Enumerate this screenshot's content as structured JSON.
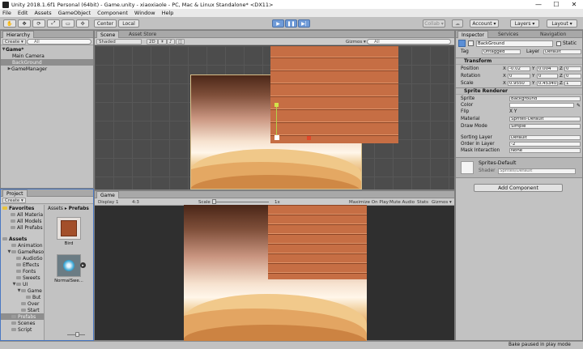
{
  "window": {
    "title": "Unity 2018.1.6f1 Personal (64bit) - Game.unity - xiaoxiaole - PC, Mac & Linux Standalone* <DX11>",
    "controls": [
      "—",
      "☐",
      "✕"
    ]
  },
  "menu": [
    "File",
    "Edit",
    "Assets",
    "GameObject",
    "Component",
    "Window",
    "Help"
  ],
  "toolbar": {
    "tools": [
      "✋",
      "✥",
      "⟳",
      "⤢",
      "▭",
      "✣"
    ],
    "pivot": "Center",
    "space": "Local",
    "play": "▶",
    "pause": "❚❚",
    "step": "▶|",
    "collab": "Collab ▾",
    "cloud": "☁",
    "account": "Account ▾",
    "layers": "Layers ▾",
    "layout": "Layout ▾"
  },
  "hierarchy": {
    "tab": "Hierarchy",
    "create": "Create ▾",
    "search": "All",
    "root": "Game*",
    "items": [
      "Main Camera",
      "BackGround",
      "GameManager"
    ],
    "root_expand": "▼",
    "gm_expand": "▶"
  },
  "scene": {
    "tabs": [
      "Scene",
      "Asset Store"
    ],
    "shading": "Shaded",
    "mode2d": "2D",
    "toggles": [
      "☀",
      "♪",
      "◫"
    ],
    "gizmos": "Gizmos ▾",
    "search": "All"
  },
  "game": {
    "tab": "Game",
    "display": "Display 1",
    "aspect": "4:3",
    "scale_label": "Scale",
    "scale_value": "1x",
    "buttons": [
      "Maximize On Play",
      "Mute Audio",
      "Stats",
      "Gizmos ▾"
    ]
  },
  "project": {
    "tab": "Project",
    "create": "Create ▾",
    "favorites_label": "Favorites",
    "favorites": [
      "All Materia",
      "All Models",
      "All Prefabs"
    ],
    "assets_label": "Assets",
    "tree": [
      {
        "label": "Animation",
        "indent": 1,
        "arrow": ""
      },
      {
        "label": "GameReso",
        "indent": 1,
        "arrow": "▼"
      },
      {
        "label": "AudioSo",
        "indent": 2,
        "arrow": ""
      },
      {
        "label": "Effects",
        "indent": 2,
        "arrow": ""
      },
      {
        "label": "Fonts",
        "indent": 2,
        "arrow": ""
      },
      {
        "label": "Sweets",
        "indent": 2,
        "arrow": ""
      },
      {
        "label": "UI",
        "indent": 2,
        "arrow": "▼"
      },
      {
        "label": "Game",
        "indent": 3,
        "arrow": "▼"
      },
      {
        "label": "But",
        "indent": 4,
        "arrow": ""
      },
      {
        "label": "Over",
        "indent": 3,
        "arrow": ""
      },
      {
        "label": "Start",
        "indent": 3,
        "arrow": ""
      },
      {
        "label": "Prefabs",
        "indent": 1,
        "arrow": "",
        "selected": true
      },
      {
        "label": "Scenes",
        "indent": 1,
        "arrow": ""
      },
      {
        "label": "Script",
        "indent": 1,
        "arrow": ""
      }
    ],
    "breadcrumb": [
      "Assets",
      "▸",
      "Prefabs"
    ],
    "assets": [
      "Bird",
      "NormalSwe..."
    ]
  },
  "inspector": {
    "tabs": [
      "Inspector",
      "Services",
      "Navigation"
    ],
    "object_name": "BackGround",
    "static_label": "Static",
    "tag_label": "Tag",
    "tag_value": "Untagged",
    "layer_label": "Layer",
    "layer_value": "Default",
    "transform": {
      "header": "Transform",
      "rows": [
        {
          "label": "Position",
          "x": "-0.02",
          "y": "0.004",
          "z": "0"
        },
        {
          "label": "Rotation",
          "x": "0",
          "y": "0",
          "z": "0"
        },
        {
          "label": "Scale",
          "x": "0.9550",
          "y": "0.45340",
          "z": "1"
        }
      ]
    },
    "sprite_renderer": {
      "header": "Sprite Renderer",
      "rows": [
        {
          "label": "Sprite",
          "value": "Background"
        },
        {
          "label": "Color",
          "value": ""
        },
        {
          "label": "Flip",
          "value": "X  Y"
        },
        {
          "label": "Material",
          "value": "Sprites-Default"
        },
        {
          "label": "Draw Mode",
          "value": "Simple"
        },
        {
          "label": "Sorting Layer",
          "value": "Default"
        },
        {
          "label": "Order in Layer",
          "value": "-2"
        },
        {
          "label": "Mask Interaction",
          "value": "None"
        }
      ]
    },
    "material_name": "Sprites-Default",
    "shader_label": "Shader",
    "shader_value": "Sprites/Default",
    "add_component": "Add Component"
  },
  "status": {
    "message": "Bake paused in play mode"
  },
  "colors": {
    "selection": "#3f72c6",
    "play_active": "#6f9bd8",
    "plank": "#c66e44"
  }
}
